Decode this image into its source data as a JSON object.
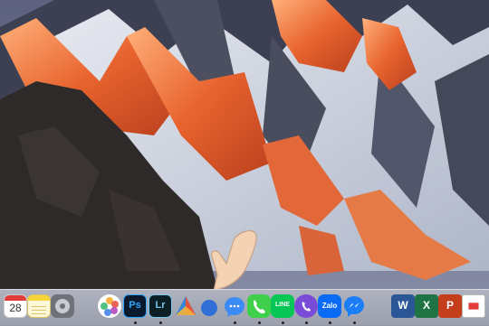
{
  "wallpaper": {
    "name": "mountain-sunset-wallpaper"
  },
  "dock": {
    "items": [
      {
        "name": "calendar",
        "icon": "calendar-icon",
        "month": "",
        "day": "28",
        "running": false
      },
      {
        "name": "notes",
        "icon": "notes-icon",
        "running": false
      },
      {
        "name": "system-preferences",
        "icon": "gear-icon",
        "running": false
      },
      {
        "name": "photos",
        "icon": "photos-icon",
        "running": false
      },
      {
        "name": "photoshop",
        "icon": "photoshop-icon",
        "label": "Ps",
        "running": true
      },
      {
        "name": "lightroom",
        "icon": "lightroom-icon",
        "label": "Lr",
        "running": true
      },
      {
        "name": "prism",
        "icon": "triangle-icon",
        "running": false
      },
      {
        "name": "app-blue",
        "icon": "app-icon",
        "running": false
      },
      {
        "name": "messages",
        "icon": "chat-bubble-icon",
        "badge": "",
        "running": true
      },
      {
        "name": "facetime",
        "icon": "phone-icon",
        "badge": "",
        "running": true
      },
      {
        "name": "line",
        "icon": "line-icon",
        "label": "LINE",
        "running": true
      },
      {
        "name": "viber",
        "icon": "viber-icon",
        "running": true
      },
      {
        "name": "zalo",
        "icon": "zalo-icon",
        "label": "Zalo",
        "running": true
      },
      {
        "name": "messenger",
        "icon": "messenger-icon",
        "running": true
      },
      {
        "name": "word",
        "icon": "word-icon",
        "label": "W",
        "running": false
      },
      {
        "name": "excel",
        "icon": "excel-icon",
        "label": "X",
        "running": false
      },
      {
        "name": "powerpoint",
        "icon": "powerpoint-icon",
        "label": "P",
        "running": false
      }
    ]
  },
  "cursor": {
    "icon": "hand-pointer-icon"
  }
}
